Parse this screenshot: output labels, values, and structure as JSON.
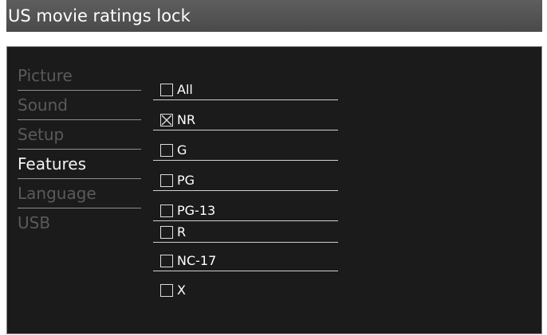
{
  "header": {
    "title": "US movie ratings lock"
  },
  "menu": {
    "items": [
      {
        "label": "Picture",
        "active": false
      },
      {
        "label": "Sound",
        "active": false
      },
      {
        "label": "Setup",
        "active": false
      },
      {
        "label": "Features",
        "active": true
      },
      {
        "label": "Language",
        "active": false
      },
      {
        "label": "USB",
        "active": false
      }
    ]
  },
  "ratings": {
    "options": [
      {
        "label": "All",
        "checked": false
      },
      {
        "label": "NR",
        "checked": true
      },
      {
        "label": "G",
        "checked": false
      },
      {
        "label": "PG",
        "checked": false
      },
      {
        "label": "PG-13",
        "checked": false
      },
      {
        "label": "R",
        "checked": false
      },
      {
        "label": "NC-17",
        "checked": false
      },
      {
        "label": "X",
        "checked": false
      }
    ]
  },
  "colors": {
    "title_bar": "#4a4a4a",
    "panel_background": "#1b1b1b",
    "menu_inactive_text": "#5a5a5a",
    "menu_active_text": "#f2f2f2",
    "option_text": "#ffffff"
  }
}
